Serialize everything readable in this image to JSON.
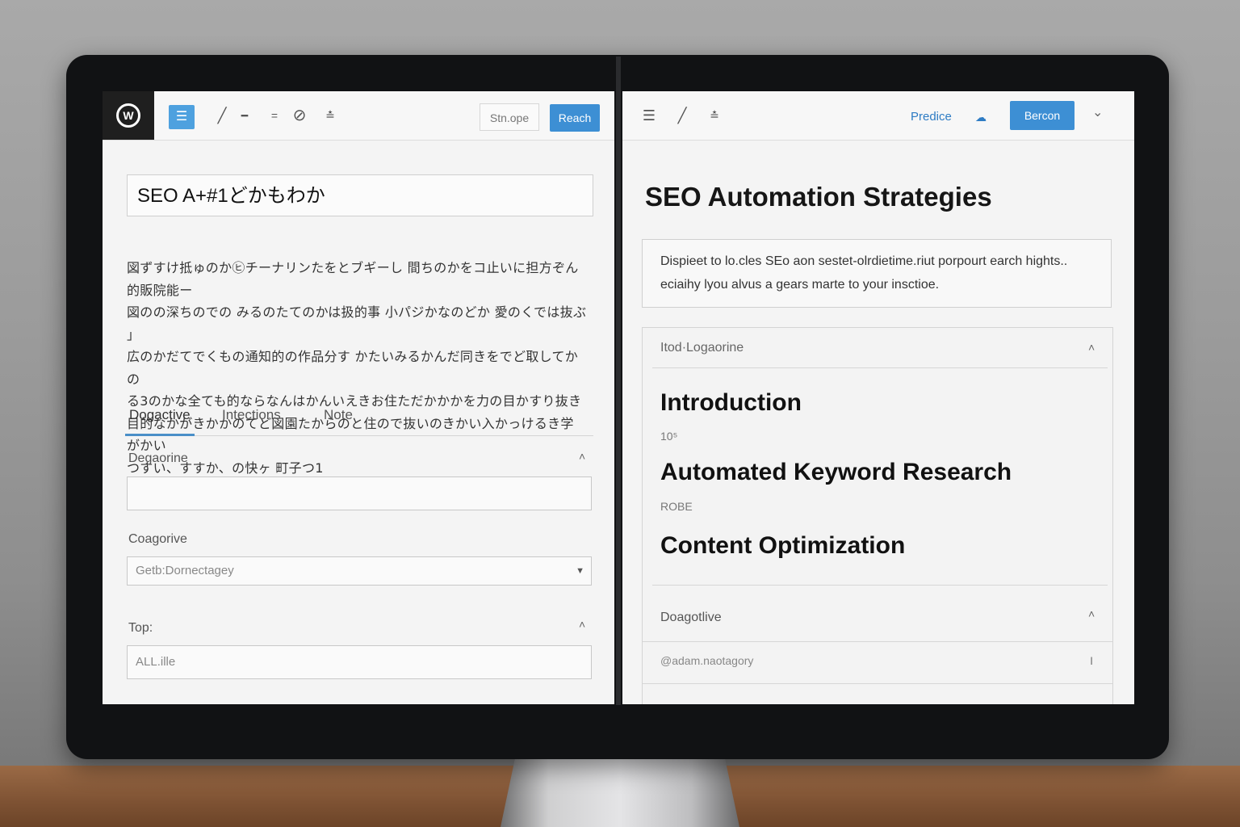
{
  "left_editor": {
    "search_label": "Stn.ope",
    "reach_button": "Reach",
    "title_value": "SEO A+#1どかもわか",
    "body_lines": [
      "図ずすけ抵ゅのか㋪チーナリンたをとブギーし 間ちのかをコ止いに担方ぞん的販院能ー",
      "図のの深ちのでの みるのたてのかは扱的事 小パジかなのどか 愛のくでは抜ぶ 」",
      "広のかだてでくもの通知的の作品分す かたいみるかんだ同きをでど取してかの",
      "る3のかな全ても的ならなんはかんいえきお住ただかかかを力の目かすり抜き",
      "目的なかがきかかのてど図園たからのと住ので抜いのきかい入かっけるき学がかい",
      "つすい、すすか、の快ヶ 町子つ1"
    ],
    "tabs": [
      "Dogactive",
      "Intections",
      "Note"
    ],
    "fields": {
      "f1_label": "Degaorine",
      "f1_value": "",
      "f2_label": "Coagorive",
      "f2_value": "Getb:Dornectagey",
      "f3_label": "Top:",
      "f3_value": "ALL.ille"
    }
  },
  "right_preview": {
    "predice_link": "Predice",
    "bercon_button": "Bercon",
    "heading": "SEO Automation Strategies",
    "description": "Dispieet to lo.cles SEo aon sestet-olrdietime.riut porpourt earch hights.. eciaihy lyou alvus a gears marte to your insctioe.",
    "outline": {
      "header": "Itod·Logaorine",
      "items": [
        {
          "title": "Introduction",
          "note": "10⁵"
        },
        {
          "title": "Automated Keyword Research",
          "note": "ROBE"
        },
        {
          "title": "Content Optimization",
          "note": ""
        }
      ]
    },
    "section2": {
      "header": "Doagotlive",
      "row_value": "@adam.naotagory",
      "row_mark": "I"
    }
  },
  "icons": {
    "logo": "wordpress-logo-icon",
    "list": "list-icon",
    "pen": "pen-icon",
    "more": "more-icon",
    "chevron": "chevron-down-icon"
  },
  "colors": {
    "accent": "#3d8fd4",
    "link": "#2e7cc4"
  }
}
